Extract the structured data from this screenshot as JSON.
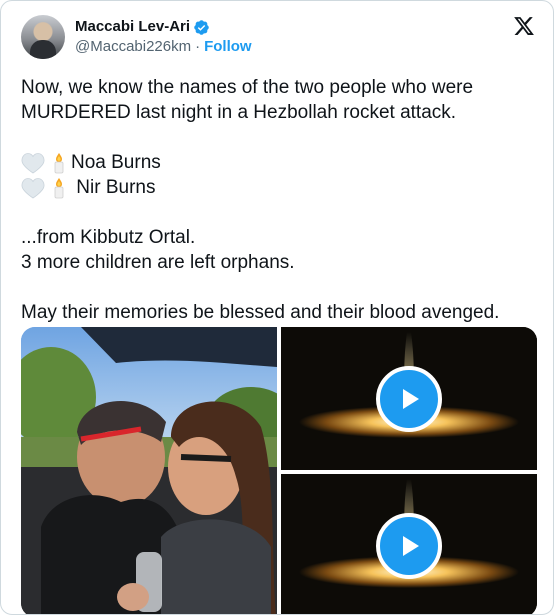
{
  "author": {
    "display_name": "Maccabi Lev-Ari",
    "handle": "@Maccabi226km",
    "separator": "·",
    "follow_label": "Follow",
    "verified": true
  },
  "tweet": {
    "line1": "Now, we know the names of the two people who were",
    "line2": "MURDERED last night in a Hezbollah rocket attack.",
    "victims": [
      {
        "name": "Noa Burns"
      },
      {
        "name": " Nir Burns"
      }
    ],
    "line3": "...from Kibbutz Ortal.",
    "line4": "3 more children are left orphans.",
    "line5": "May their memories be blessed and their blood avenged."
  },
  "media": {
    "photo_icon": "photo-couple",
    "videos": [
      {
        "icon": "play-icon"
      },
      {
        "icon": "play-icon"
      }
    ]
  },
  "colors": {
    "accent": "#1d9bf0",
    "text": "#0f1419",
    "secondary_text": "#536471",
    "border": "#cfd9de"
  }
}
